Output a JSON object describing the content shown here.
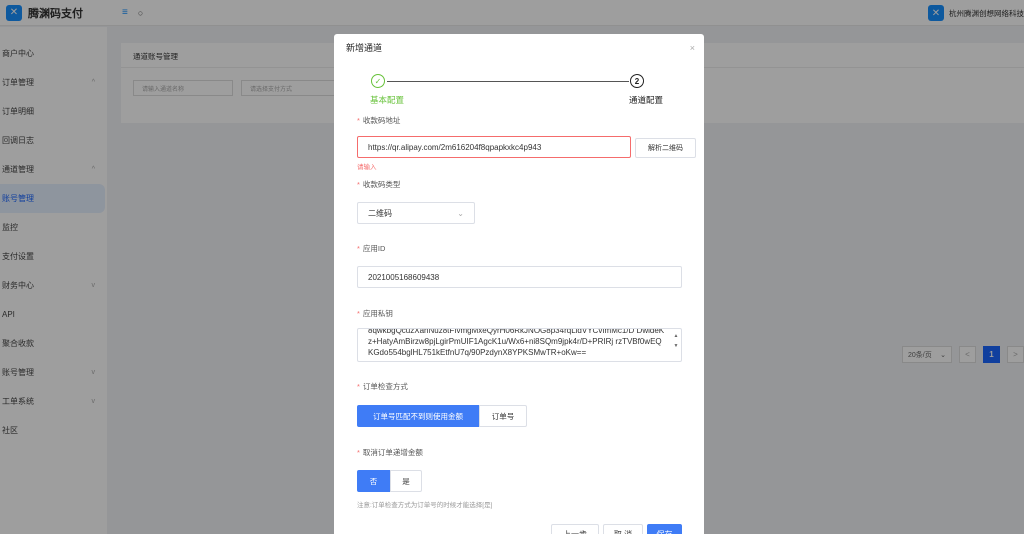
{
  "header": {
    "brand_name": "腾渊码支付",
    "menu_icon": "≡",
    "search_icon": "○",
    "company_name": "杭州腾渊创想网络科技"
  },
  "sidebar": {
    "items": [
      {
        "label": "商户中心",
        "chevron": ""
      },
      {
        "label": "订单管理",
        "chevron": "^"
      },
      {
        "label": "订单明细",
        "chevron": ""
      },
      {
        "label": "回调日志",
        "chevron": ""
      },
      {
        "label": "通道管理",
        "chevron": "^"
      },
      {
        "label": "账号管理",
        "chevron": ""
      },
      {
        "label": "监控",
        "chevron": ""
      },
      {
        "label": "支付设置",
        "chevron": ""
      },
      {
        "label": "财务中心",
        "chevron": "v"
      },
      {
        "label": "API",
        "chevron": ""
      },
      {
        "label": "聚合收款",
        "chevron": ""
      },
      {
        "label": "账号管理",
        "chevron": "v"
      },
      {
        "label": "工单系统",
        "chevron": "v"
      },
      {
        "label": "社区",
        "chevron": ""
      }
    ]
  },
  "main": {
    "title": "通道账号管理",
    "filter_name_placeholder": "请输入通道名称",
    "filter_pay_placeholder": "请选择支付方式",
    "page_size": "20条/页",
    "page_current": "1",
    "page_prev": "<",
    "page_next": ">"
  },
  "modal": {
    "title": "新增通道",
    "close": "×",
    "step1_icon": "✓",
    "step1_label": "基本配置",
    "step2_icon": "2",
    "step2_label": "通道配置",
    "qr_address_label": "收款码地址",
    "qr_address_value": "https://qr.alipay.com/2m616204f8qpapkxkc4p943",
    "qr_parse_button": "解析二维码",
    "qr_error": "请输入",
    "qr_type_label": "收款码类型",
    "qr_type_value": "二维码",
    "app_id_label": "应用ID",
    "app_id_value": "2021005168609438",
    "private_key_label": "应用私钥",
    "private_key_value": "8qwkbgQcuzXahNuz8tFIvmgMxeQyrH06RkJNOG8p34rqLidVYCvImMc1/D DwldeKz+HatyAmBirzw8pjLgirPmUIF1AgcK1u/Wx6+ni8SQm9jpk4r/D+PRIRj rzTVBf0wEQKGdo554bglHL751kEtfnU7q/90PzdynX8YPKSMwTR+oKw==",
    "check_method_label": "订单检查方式",
    "check_method_options": [
      "订单号匹配不到则使用金额",
      "订单号"
    ],
    "cancel_increment_label": "取消订单递增金额",
    "cancel_increment_options": [
      "否",
      "是"
    ],
    "note": "注意:订单检查方式为订单号的时候才能选择[是]",
    "prev_button": "上一步",
    "cancel_button": "取 消",
    "save_button": "保存"
  },
  "colors": {
    "primary": "#3f7cf6",
    "success": "#67c23a",
    "danger": "#f56c6c"
  }
}
